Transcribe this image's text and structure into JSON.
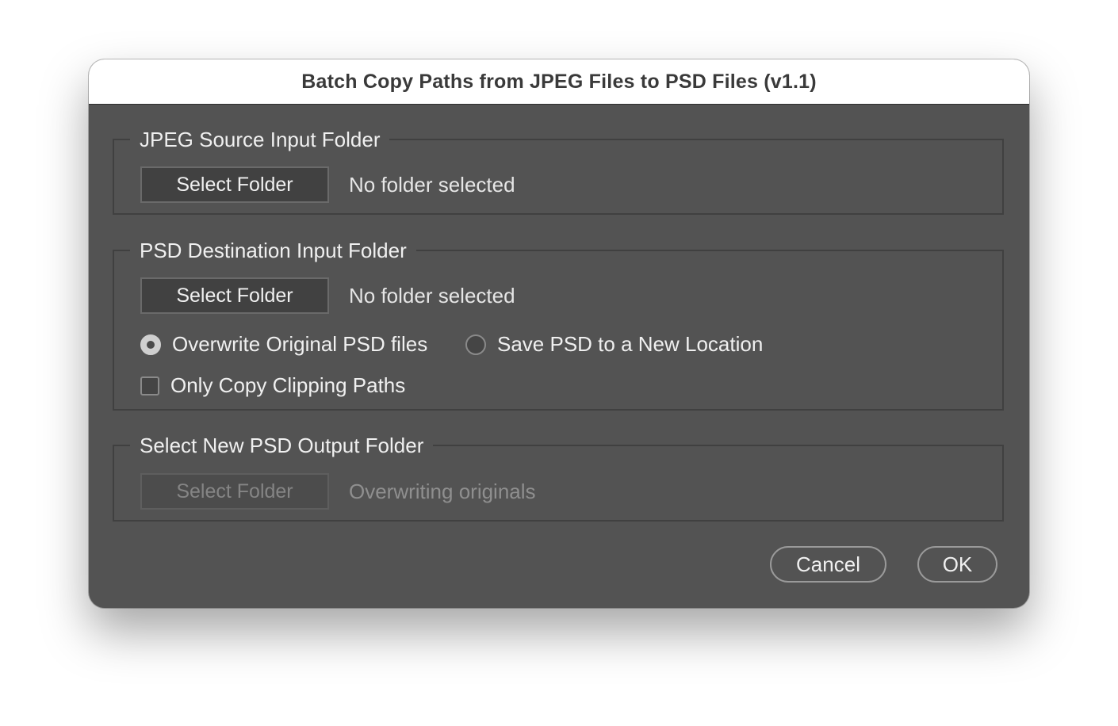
{
  "dialog": {
    "title": "Batch Copy Paths from JPEG Files to PSD Files (v1.1)"
  },
  "source_group": {
    "legend": "JPEG Source Input Folder",
    "button_label": "Select Folder",
    "status": "No folder selected"
  },
  "destination_group": {
    "legend": "PSD Destination Input Folder",
    "button_label": "Select Folder",
    "status": "No folder selected",
    "radio_overwrite": {
      "label": "Overwrite Original PSD files",
      "checked": true
    },
    "radio_new_location": {
      "label": "Save PSD to a New Location",
      "checked": false
    },
    "checkbox_clipping": {
      "label": "Only Copy Clipping Paths",
      "checked": false
    }
  },
  "output_group": {
    "legend": "Select New PSD Output Folder",
    "button_label": "Select Folder",
    "button_disabled": true,
    "status": "Overwriting originals"
  },
  "footer": {
    "cancel_label": "Cancel",
    "ok_label": "OK"
  },
  "colors": {
    "dialog_background": "#535353",
    "titlebar_background": "#ffffff",
    "group_border": "#404040",
    "text": "#f0f0f0",
    "disabled_text": "#858585"
  }
}
